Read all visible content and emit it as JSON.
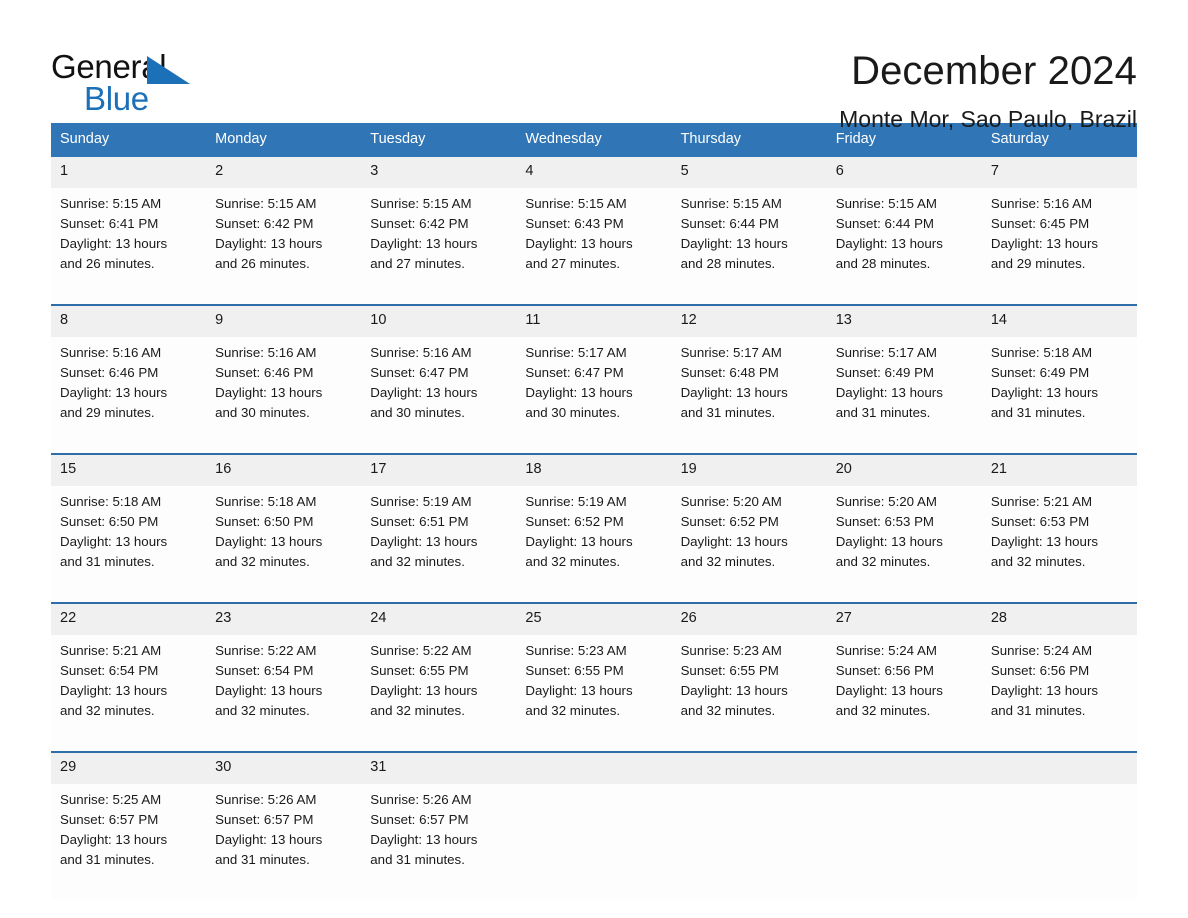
{
  "brand": {
    "word_one": "General",
    "word_two": "Blue",
    "triangle_icon": "brand-triangle-icon"
  },
  "header": {
    "title": "December 2024",
    "location": "Monte Mor, Sao Paulo, Brazil"
  },
  "colors": {
    "header_blue": "#3075b5",
    "row_border_blue": "#2e6da8",
    "daynum_band": "#f0f0f0",
    "brand_blue": "#1b70b8",
    "text": "#1a1a1a"
  },
  "weekdays": [
    "Sunday",
    "Monday",
    "Tuesday",
    "Wednesday",
    "Thursday",
    "Friday",
    "Saturday"
  ],
  "labels": {
    "sunrise_prefix": "Sunrise:",
    "sunset_prefix": "Sunset:",
    "daylight_prefix": "Daylight:"
  },
  "weeks": [
    {
      "days": [
        {
          "num": "1",
          "l1": "Sunrise: 5:15 AM",
          "l2": "Sunset: 6:41 PM",
          "l3": "Daylight: 13 hours",
          "l4": "and 26 minutes."
        },
        {
          "num": "2",
          "l1": "Sunrise: 5:15 AM",
          "l2": "Sunset: 6:42 PM",
          "l3": "Daylight: 13 hours",
          "l4": "and 26 minutes."
        },
        {
          "num": "3",
          "l1": "Sunrise: 5:15 AM",
          "l2": "Sunset: 6:42 PM",
          "l3": "Daylight: 13 hours",
          "l4": "and 27 minutes."
        },
        {
          "num": "4",
          "l1": "Sunrise: 5:15 AM",
          "l2": "Sunset: 6:43 PM",
          "l3": "Daylight: 13 hours",
          "l4": "and 27 minutes."
        },
        {
          "num": "5",
          "l1": "Sunrise: 5:15 AM",
          "l2": "Sunset: 6:44 PM",
          "l3": "Daylight: 13 hours",
          "l4": "and 28 minutes."
        },
        {
          "num": "6",
          "l1": "Sunrise: 5:15 AM",
          "l2": "Sunset: 6:44 PM",
          "l3": "Daylight: 13 hours",
          "l4": "and 28 minutes."
        },
        {
          "num": "7",
          "l1": "Sunrise: 5:16 AM",
          "l2": "Sunset: 6:45 PM",
          "l3": "Daylight: 13 hours",
          "l4": "and 29 minutes."
        }
      ]
    },
    {
      "days": [
        {
          "num": "8",
          "l1": "Sunrise: 5:16 AM",
          "l2": "Sunset: 6:46 PM",
          "l3": "Daylight: 13 hours",
          "l4": "and 29 minutes."
        },
        {
          "num": "9",
          "l1": "Sunrise: 5:16 AM",
          "l2": "Sunset: 6:46 PM",
          "l3": "Daylight: 13 hours",
          "l4": "and 30 minutes."
        },
        {
          "num": "10",
          "l1": "Sunrise: 5:16 AM",
          "l2": "Sunset: 6:47 PM",
          "l3": "Daylight: 13 hours",
          "l4": "and 30 minutes."
        },
        {
          "num": "11",
          "l1": "Sunrise: 5:17 AM",
          "l2": "Sunset: 6:47 PM",
          "l3": "Daylight: 13 hours",
          "l4": "and 30 minutes."
        },
        {
          "num": "12",
          "l1": "Sunrise: 5:17 AM",
          "l2": "Sunset: 6:48 PM",
          "l3": "Daylight: 13 hours",
          "l4": "and 31 minutes."
        },
        {
          "num": "13",
          "l1": "Sunrise: 5:17 AM",
          "l2": "Sunset: 6:49 PM",
          "l3": "Daylight: 13 hours",
          "l4": "and 31 minutes."
        },
        {
          "num": "14",
          "l1": "Sunrise: 5:18 AM",
          "l2": "Sunset: 6:49 PM",
          "l3": "Daylight: 13 hours",
          "l4": "and 31 minutes."
        }
      ]
    },
    {
      "days": [
        {
          "num": "15",
          "l1": "Sunrise: 5:18 AM",
          "l2": "Sunset: 6:50 PM",
          "l3": "Daylight: 13 hours",
          "l4": "and 31 minutes."
        },
        {
          "num": "16",
          "l1": "Sunrise: 5:18 AM",
          "l2": "Sunset: 6:50 PM",
          "l3": "Daylight: 13 hours",
          "l4": "and 32 minutes."
        },
        {
          "num": "17",
          "l1": "Sunrise: 5:19 AM",
          "l2": "Sunset: 6:51 PM",
          "l3": "Daylight: 13 hours",
          "l4": "and 32 minutes."
        },
        {
          "num": "18",
          "l1": "Sunrise: 5:19 AM",
          "l2": "Sunset: 6:52 PM",
          "l3": "Daylight: 13 hours",
          "l4": "and 32 minutes."
        },
        {
          "num": "19",
          "l1": "Sunrise: 5:20 AM",
          "l2": "Sunset: 6:52 PM",
          "l3": "Daylight: 13 hours",
          "l4": "and 32 minutes."
        },
        {
          "num": "20",
          "l1": "Sunrise: 5:20 AM",
          "l2": "Sunset: 6:53 PM",
          "l3": "Daylight: 13 hours",
          "l4": "and 32 minutes."
        },
        {
          "num": "21",
          "l1": "Sunrise: 5:21 AM",
          "l2": "Sunset: 6:53 PM",
          "l3": "Daylight: 13 hours",
          "l4": "and 32 minutes."
        }
      ]
    },
    {
      "days": [
        {
          "num": "22",
          "l1": "Sunrise: 5:21 AM",
          "l2": "Sunset: 6:54 PM",
          "l3": "Daylight: 13 hours",
          "l4": "and 32 minutes."
        },
        {
          "num": "23",
          "l1": "Sunrise: 5:22 AM",
          "l2": "Sunset: 6:54 PM",
          "l3": "Daylight: 13 hours",
          "l4": "and 32 minutes."
        },
        {
          "num": "24",
          "l1": "Sunrise: 5:22 AM",
          "l2": "Sunset: 6:55 PM",
          "l3": "Daylight: 13 hours",
          "l4": "and 32 minutes."
        },
        {
          "num": "25",
          "l1": "Sunrise: 5:23 AM",
          "l2": "Sunset: 6:55 PM",
          "l3": "Daylight: 13 hours",
          "l4": "and 32 minutes."
        },
        {
          "num": "26",
          "l1": "Sunrise: 5:23 AM",
          "l2": "Sunset: 6:55 PM",
          "l3": "Daylight: 13 hours",
          "l4": "and 32 minutes."
        },
        {
          "num": "27",
          "l1": "Sunrise: 5:24 AM",
          "l2": "Sunset: 6:56 PM",
          "l3": "Daylight: 13 hours",
          "l4": "and 32 minutes."
        },
        {
          "num": "28",
          "l1": "Sunrise: 5:24 AM",
          "l2": "Sunset: 6:56 PM",
          "l3": "Daylight: 13 hours",
          "l4": "and 31 minutes."
        }
      ]
    },
    {
      "days": [
        {
          "num": "29",
          "l1": "Sunrise: 5:25 AM",
          "l2": "Sunset: 6:57 PM",
          "l3": "Daylight: 13 hours",
          "l4": "and 31 minutes."
        },
        {
          "num": "30",
          "l1": "Sunrise: 5:26 AM",
          "l2": "Sunset: 6:57 PM",
          "l3": "Daylight: 13 hours",
          "l4": "and 31 minutes."
        },
        {
          "num": "31",
          "l1": "Sunrise: 5:26 AM",
          "l2": "Sunset: 6:57 PM",
          "l3": "Daylight: 13 hours",
          "l4": "and 31 minutes."
        },
        {
          "num": "",
          "l1": "",
          "l2": "",
          "l3": "",
          "l4": ""
        },
        {
          "num": "",
          "l1": "",
          "l2": "",
          "l3": "",
          "l4": ""
        },
        {
          "num": "",
          "l1": "",
          "l2": "",
          "l3": "",
          "l4": ""
        },
        {
          "num": "",
          "l1": "",
          "l2": "",
          "l3": "",
          "l4": ""
        }
      ]
    }
  ]
}
